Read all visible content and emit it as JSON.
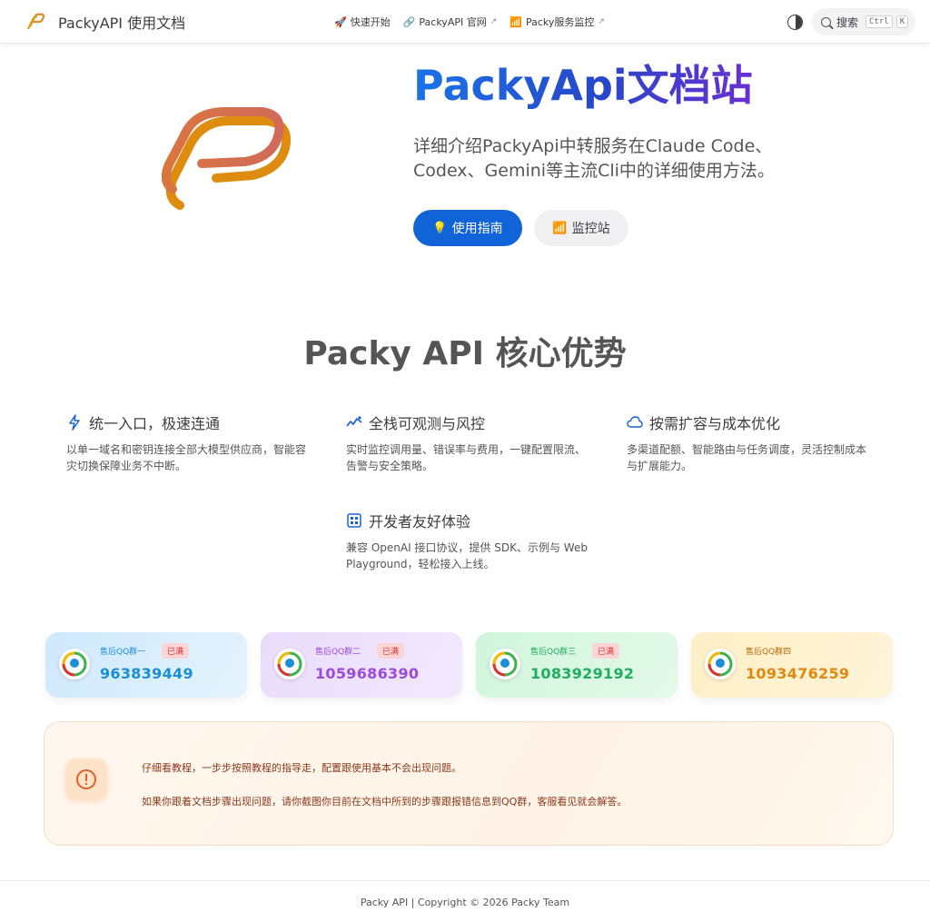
{
  "header": {
    "brand_title": "PackyAPI 使用文档",
    "nav": [
      {
        "icon": "rocket-icon",
        "label": "快速开始",
        "external": false
      },
      {
        "icon": "link-icon",
        "label": "PackyAPI 官网",
        "external": true
      },
      {
        "icon": "chart-icon",
        "label": "Packy服务监控",
        "external": true
      }
    ],
    "search_label": "搜索",
    "search_keys": [
      "Ctrl",
      "K"
    ]
  },
  "hero": {
    "title": "PackyApi文档站",
    "description": "详细介绍PackyApi中转服务在Claude Code、Codex、Gemini等主流Cli中的详细使用方法。",
    "primary_button": "使用指南",
    "secondary_button": "监控站"
  },
  "features": {
    "title": "Packy API 核心优势",
    "items": [
      {
        "icon": "lightning-icon",
        "title": "统一入口，极速连通",
        "desc": "以单一域名和密钥连接全部大模型供应商，智能容灾切换保障业务不中断。"
      },
      {
        "icon": "activity-icon",
        "title": "全栈可观测与风控",
        "desc": "实时监控调用量、错误率与费用，一键配置限流、告警与安全策略。"
      },
      {
        "icon": "cloud-icon",
        "title": "按需扩容与成本优化",
        "desc": "多渠道配额、智能路由与任务调度，灵活控制成本与扩展能力。"
      },
      {
        "icon": "chip-icon",
        "title": "开发者友好体验",
        "desc": "兼容 OpenAI 接口协议，提供 SDK、示例与 Web Playground，轻松接入上线。"
      }
    ]
  },
  "qq_groups": [
    {
      "label": "售后QQ群一",
      "badge": "已满",
      "number": "963839449",
      "color": "#1a8fd8"
    },
    {
      "label": "售后QQ群二",
      "badge": "已满",
      "number": "1059686390",
      "color": "#9b4be0"
    },
    {
      "label": "售后QQ群三",
      "badge": "已满",
      "number": "1083929192",
      "color": "#1fae5e"
    },
    {
      "label": "售后QQ群四",
      "badge": "",
      "number": "1093476259",
      "color": "#e0890f"
    }
  ],
  "notice": {
    "line1": "仔细看教程，一步步按照教程的指导走，配置跟使用基本不会出现问题。",
    "line2": "如果你跟着文档步骤出现问题，请你截图你目前在文档中所到的步骤跟报错信息到QQ群，客服看见就会解答。"
  },
  "footer": {
    "text": "Packy API | Copyright © 2026 Packy Team"
  }
}
